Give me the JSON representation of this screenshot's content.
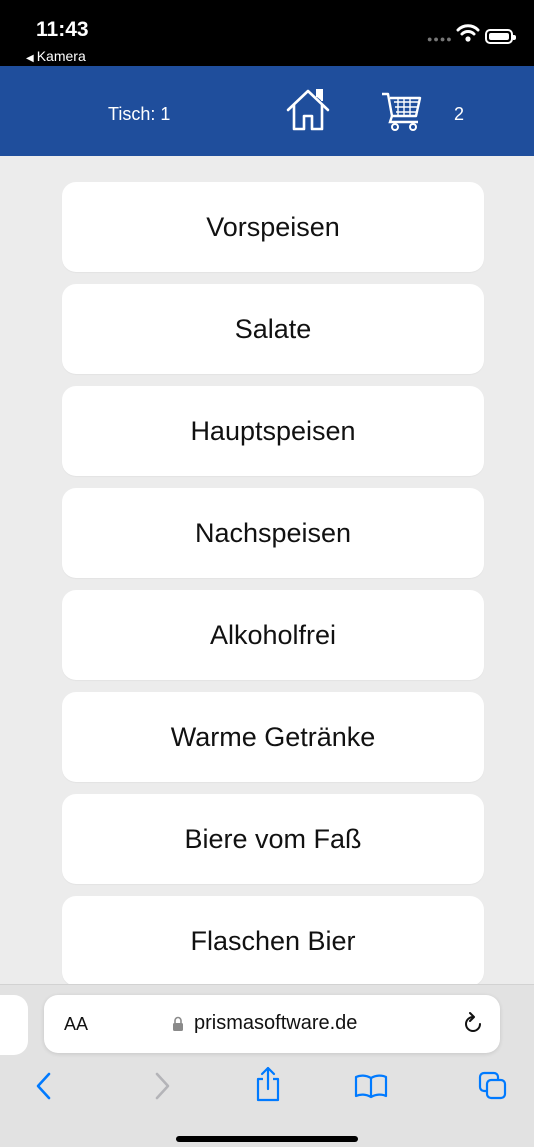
{
  "status_bar": {
    "time": "11:43",
    "back_app": "Kamera"
  },
  "header": {
    "table_label": "Tisch: 1",
    "home_icon": "home-icon",
    "cart_icon": "cart-icon",
    "cart_count": "2",
    "background_color": "#1f4e9c"
  },
  "categories": [
    {
      "label": "Vorspeisen"
    },
    {
      "label": "Salate"
    },
    {
      "label": "Hauptspeisen"
    },
    {
      "label": "Nachspeisen"
    },
    {
      "label": "Alkoholfrei"
    },
    {
      "label": "Warme Getränke"
    },
    {
      "label": "Biere vom Faß"
    },
    {
      "label": "Flaschen Bier"
    }
  ],
  "browser": {
    "text_size_button": "AA",
    "domain": "prismasoftware.de",
    "accent_color": "#007aff",
    "toolbar": {
      "back": "chevron-left-icon",
      "forward": "chevron-right-icon",
      "share": "share-icon",
      "bookmarks": "book-icon",
      "tabs": "tabs-icon"
    }
  }
}
